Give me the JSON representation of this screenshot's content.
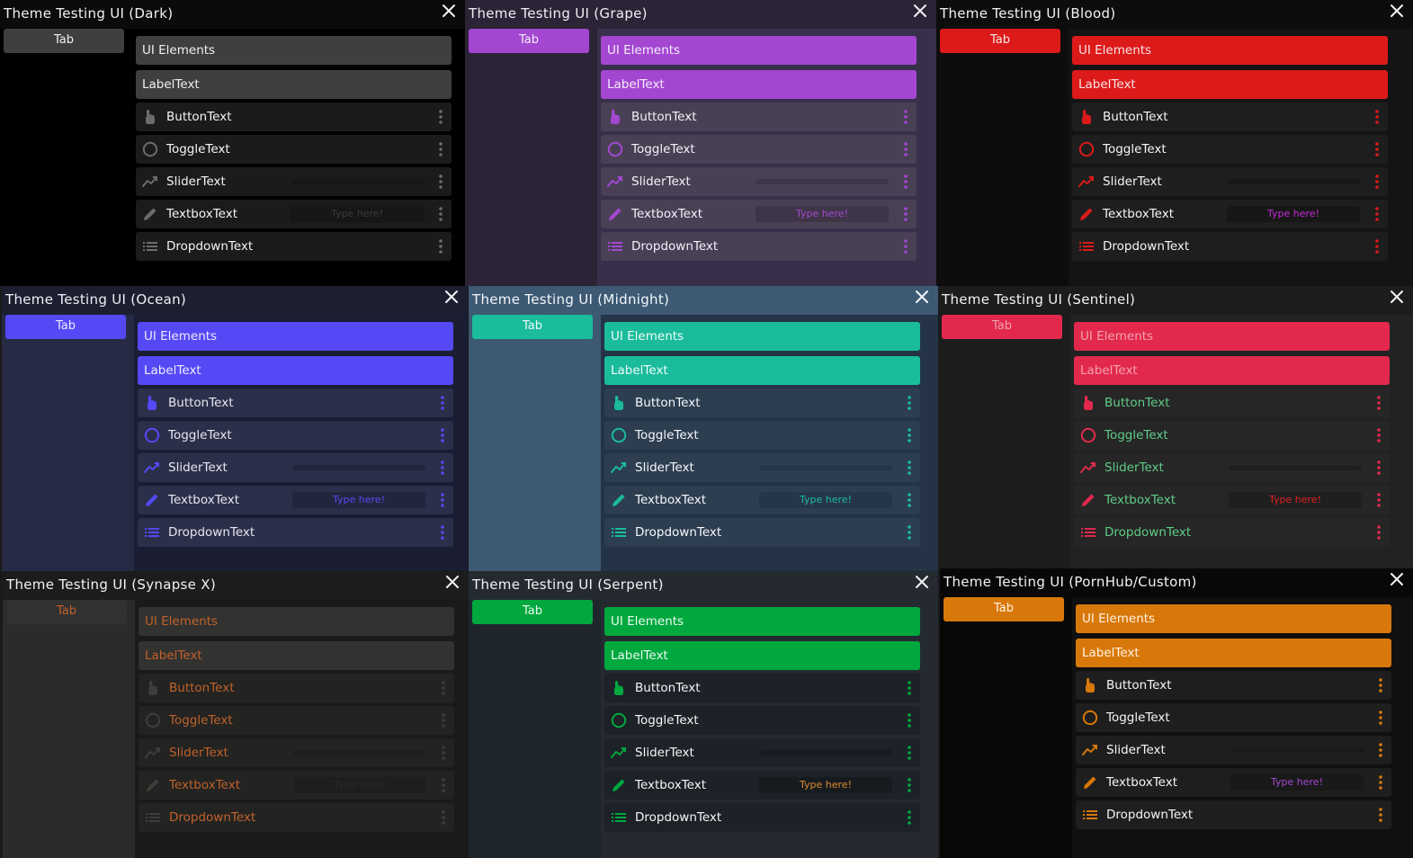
{
  "common": {
    "tab_label": "Tab",
    "header_label": "UI Elements",
    "label_text": "LabelText",
    "button_text": "ButtonText",
    "toggle_text": "ToggleText",
    "slider_text": "SliderText",
    "textbox_text": "TextboxText",
    "textbox_placeholder": "Type here!",
    "dropdown_text": "DropdownText",
    "icons": [
      "hand-pointer-icon",
      "circle-icon",
      "trending-line-icon",
      "pencil-icon",
      "list-icon",
      "more-vertical-icon",
      "close-icon"
    ]
  },
  "windows": [
    {
      "id": "dark",
      "title": "Theme Testing UI (Dark)",
      "colors": {
        "title_bg": "#0b0b0b",
        "title_text": "#f2f2f2",
        "sidebar": "#000000",
        "content": "#000000",
        "accent": "#3f3f3f",
        "header_text": "#f0f0f0",
        "row": "#1b1b1b",
        "row_text": "#f5f5f5",
        "icon": "#6c6c6c",
        "control": "#161616",
        "placeholder": "#3a3a3a"
      }
    },
    {
      "id": "grape",
      "title": "Theme Testing UI (Grape)",
      "colors": {
        "title_bg": "#2c2336",
        "title_text": "#f0eef4",
        "sidebar": "#2c2336",
        "content": "#38304a",
        "accent": "#a347d2",
        "header_text": "#f5ecfa",
        "row": "#4a4055",
        "row_text": "#f4f0f7",
        "icon": "#a347d2",
        "control": "#3f3548",
        "placeholder": "#a347d2"
      }
    },
    {
      "id": "blood",
      "title": "Theme Testing UI (Blood)",
      "colors": {
        "title_bg": "#0d0d0d",
        "title_text": "#f2f2f2",
        "sidebar": "#0d0d0d",
        "content": "#141414",
        "accent": "#dc1a1a",
        "header_text": "#f8e4e4",
        "row": "#1e1e1e",
        "row_text": "#f5f5f5",
        "icon": "#dc1a1a",
        "control": "#171717",
        "placeholder": "#c42ad6"
      }
    },
    {
      "id": "ocean",
      "title": "Theme Testing UI (Ocean)",
      "colors": {
        "title_bg": "#1c1f30",
        "title_text": "#f0f0f6",
        "sidebar": "#262a44",
        "content": "#1b1e32",
        "accent": "#5449f5",
        "header_text": "#eeeaff",
        "row": "#2b2f4a",
        "row_text": "#e6e6ef",
        "icon": "#5449f5",
        "control": "#22263d",
        "placeholder": "#5449f5"
      }
    },
    {
      "id": "midnight",
      "title": "Theme Testing UI (Midnight)",
      "colors": {
        "title_bg": "#3d5973",
        "title_text": "#f2f6fa",
        "sidebar": "#3d5973",
        "content": "#243446",
        "accent": "#1abc9c",
        "header_text": "#ecfbf7",
        "row": "#2c3e50",
        "row_text": "#f5f7fa",
        "icon": "#1abc9c",
        "control": "#26364a",
        "placeholder": "#1abc9c"
      }
    },
    {
      "id": "sentinel",
      "title": "Theme Testing UI (Sentinel)",
      "colors": {
        "title_bg": "#1c1c1c",
        "title_text": "#f2f2f2",
        "sidebar": "#1c1c1c",
        "content": "#222222",
        "accent": "#e2294d",
        "header_text": "#f2a0b0",
        "row": "#262626",
        "row_text": "#5fcc86",
        "icon": "#e2294d",
        "control": "#1f1f1f",
        "placeholder": "#e02020"
      }
    },
    {
      "id": "synapse",
      "title": "Theme Testing UI (Synapse X)",
      "colors": {
        "title_bg": "#1c1c1c",
        "title_text": "#f2f2f2",
        "sidebar": "#2b2b29",
        "content": "#1a1a19",
        "accent": "#323230",
        "header_text": "#c0622a",
        "row": "#232322",
        "row_text": "#c0622a",
        "icon": "#3d3d3b",
        "control": "#1e1e1d",
        "placeholder": "#282826"
      }
    },
    {
      "id": "serpent",
      "title": "Theme Testing UI (Serpent)",
      "colors": {
        "title_bg": "#252a31",
        "title_text": "#f2f2f2",
        "sidebar": "#1e262b",
        "content": "#242a30",
        "accent": "#00a83e",
        "header_text": "#eafaf0",
        "row": "#1c2227",
        "row_text": "#f5f5f5",
        "icon": "#00a83e",
        "control": "#161b20",
        "placeholder": "#e08a2a"
      }
    },
    {
      "id": "pornhub",
      "title": "Theme Testing UI (PornHub/Custom)",
      "colors": {
        "title_bg": "#080808",
        "title_text": "#f2f2f2",
        "sidebar": "#080808",
        "content": "#101010",
        "accent": "#d8780a",
        "header_text": "#fff3e2",
        "row": "#1e1e1e",
        "row_text": "#f5f5f5",
        "icon": "#d8780a",
        "control": "#191919",
        "placeholder": "#a347d2"
      }
    }
  ]
}
